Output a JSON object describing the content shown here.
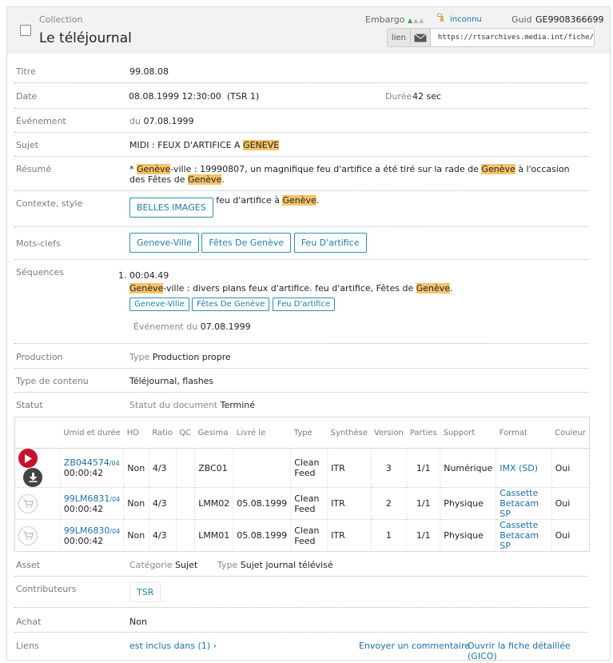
{
  "header": {
    "collection_label": "Collection",
    "title": "Le téléjournal",
    "embargo_label": "Embargo",
    "lock_status": "inconnu",
    "guid_label": "Guid",
    "guid_value": "GE9908366699",
    "lien_label": "lien",
    "url": "https://rtsarchives.media.int/fiche/"
  },
  "fields": {
    "titre": {
      "label": "Titre",
      "value": "99.08.08"
    },
    "date": {
      "label": "Date",
      "value": "08.08.1999 12:30:00  (TSR 1)",
      "duree_label": "Durée",
      "duree_value": "42 sec"
    },
    "evenement": {
      "label": "Événement",
      "prefix": "du",
      "value": "07.08.1999"
    },
    "sujet": {
      "label": "Sujet",
      "before": "MIDI : FEUX D'ARTIFICE A ",
      "highlight": "GENEVE"
    },
    "resume": {
      "label": "Résumé",
      "p1": "* ",
      "h1": "Genève",
      "p2": "-ville : 19990807, un magnifique feu d'artifice a été tiré sur la rade de ",
      "h2": "Genève",
      "p3": " à l'occasion des Fêtes de ",
      "h3": "Genève",
      "p4": "."
    },
    "contexte": {
      "label": "Contexte, style",
      "tag": "BELLES IMAGES",
      "before": "feu d'artifice à ",
      "highlight": "Genève",
      "after": "."
    },
    "mots_clefs": {
      "label": "Mots-clefs",
      "tags": [
        "Geneve-Ville",
        "Fêtes De Genève",
        "Feu D'artifice"
      ]
    },
    "sequences": {
      "label": "Séquences",
      "number": "1.",
      "time": "00:04.49",
      "h1": "Genève",
      "p1": "-ville : divers plans feux d'artifice. feu d'artifice, Fêtes de ",
      "h2": "Genève",
      "p2": ".",
      "tags": [
        "Geneve-Ville",
        "Fêtes De Genève",
        "Feu D'artifice"
      ],
      "event_label": "Événement du",
      "event_value": "07.08.1999"
    },
    "production": {
      "label": "Production",
      "type_label": "Type",
      "value": "Production propre"
    },
    "type_contenu": {
      "label": "Type de contenu",
      "value": "Téléjournal, flashes"
    },
    "statut": {
      "label": "Statut",
      "sub_label": "Statut du document",
      "value": "Terminé"
    },
    "asset": {
      "label": "Asset",
      "cat_label": "Catégorie",
      "cat_value": "Sujet",
      "type_label": "Type",
      "type_value": "Sujet journal télévisé"
    },
    "contributeurs": {
      "label": "Contributeurs",
      "value": "TSR"
    },
    "achat": {
      "label": "Achat",
      "value": "Non"
    },
    "liens": {
      "label": "Liens",
      "inclus": "est inclus dans (1)",
      "commentaire": "Envoyer un commentaire",
      "gico": "Ouvrir la fiche détaillée (GICO)"
    }
  },
  "media_table": {
    "headers": [
      "Umid et durée",
      "HD",
      "Ratio",
      "QC",
      "Gesima",
      "Livré le",
      "Type",
      "Synthèse",
      "Version",
      "Parties",
      "Support",
      "Format",
      "Couleur"
    ],
    "rows": [
      {
        "actions": "play-download",
        "umid": "ZB044574",
        "umid_suffix": "/04",
        "duration": "00:00:42",
        "hd": "Non",
        "ratio": "4/3",
        "qc": "",
        "gesima": "ZBC01",
        "livre": "",
        "type": "Clean Feed",
        "synthese": "ITR",
        "version": "3",
        "parties": "1/1",
        "support": "Numérique",
        "format": "IMX (SD)",
        "couleur": "Oui"
      },
      {
        "actions": "cart",
        "umid": "99LM6831",
        "umid_suffix": "/04",
        "duration": "00:00:42",
        "hd": "Non",
        "ratio": "4/3",
        "qc": "",
        "gesima": "LMM02",
        "livre": "05.08.1999",
        "type": "Clean Feed",
        "synthese": "ITR",
        "version": "2",
        "parties": "1/1",
        "support": "Physique",
        "format": "Cassette Betacam SP",
        "couleur": "Oui"
      },
      {
        "actions": "cart",
        "umid": "99LM6830",
        "umid_suffix": "/04",
        "duration": "00:00:42",
        "hd": "Non",
        "ratio": "4/3",
        "qc": "",
        "gesima": "LMM01",
        "livre": "05.08.1999",
        "type": "Clean Feed",
        "synthese": "ITR",
        "version": "1",
        "parties": "1/1",
        "support": "Physique",
        "format": "Cassette Betacam SP",
        "couleur": "Oui"
      }
    ]
  },
  "colors": {
    "highlight": "#f5c36b",
    "link": "#1d6fa8",
    "tag_border": "#2a8fb0",
    "play": "#c8102e",
    "embargo_on": "#3aa63a"
  }
}
